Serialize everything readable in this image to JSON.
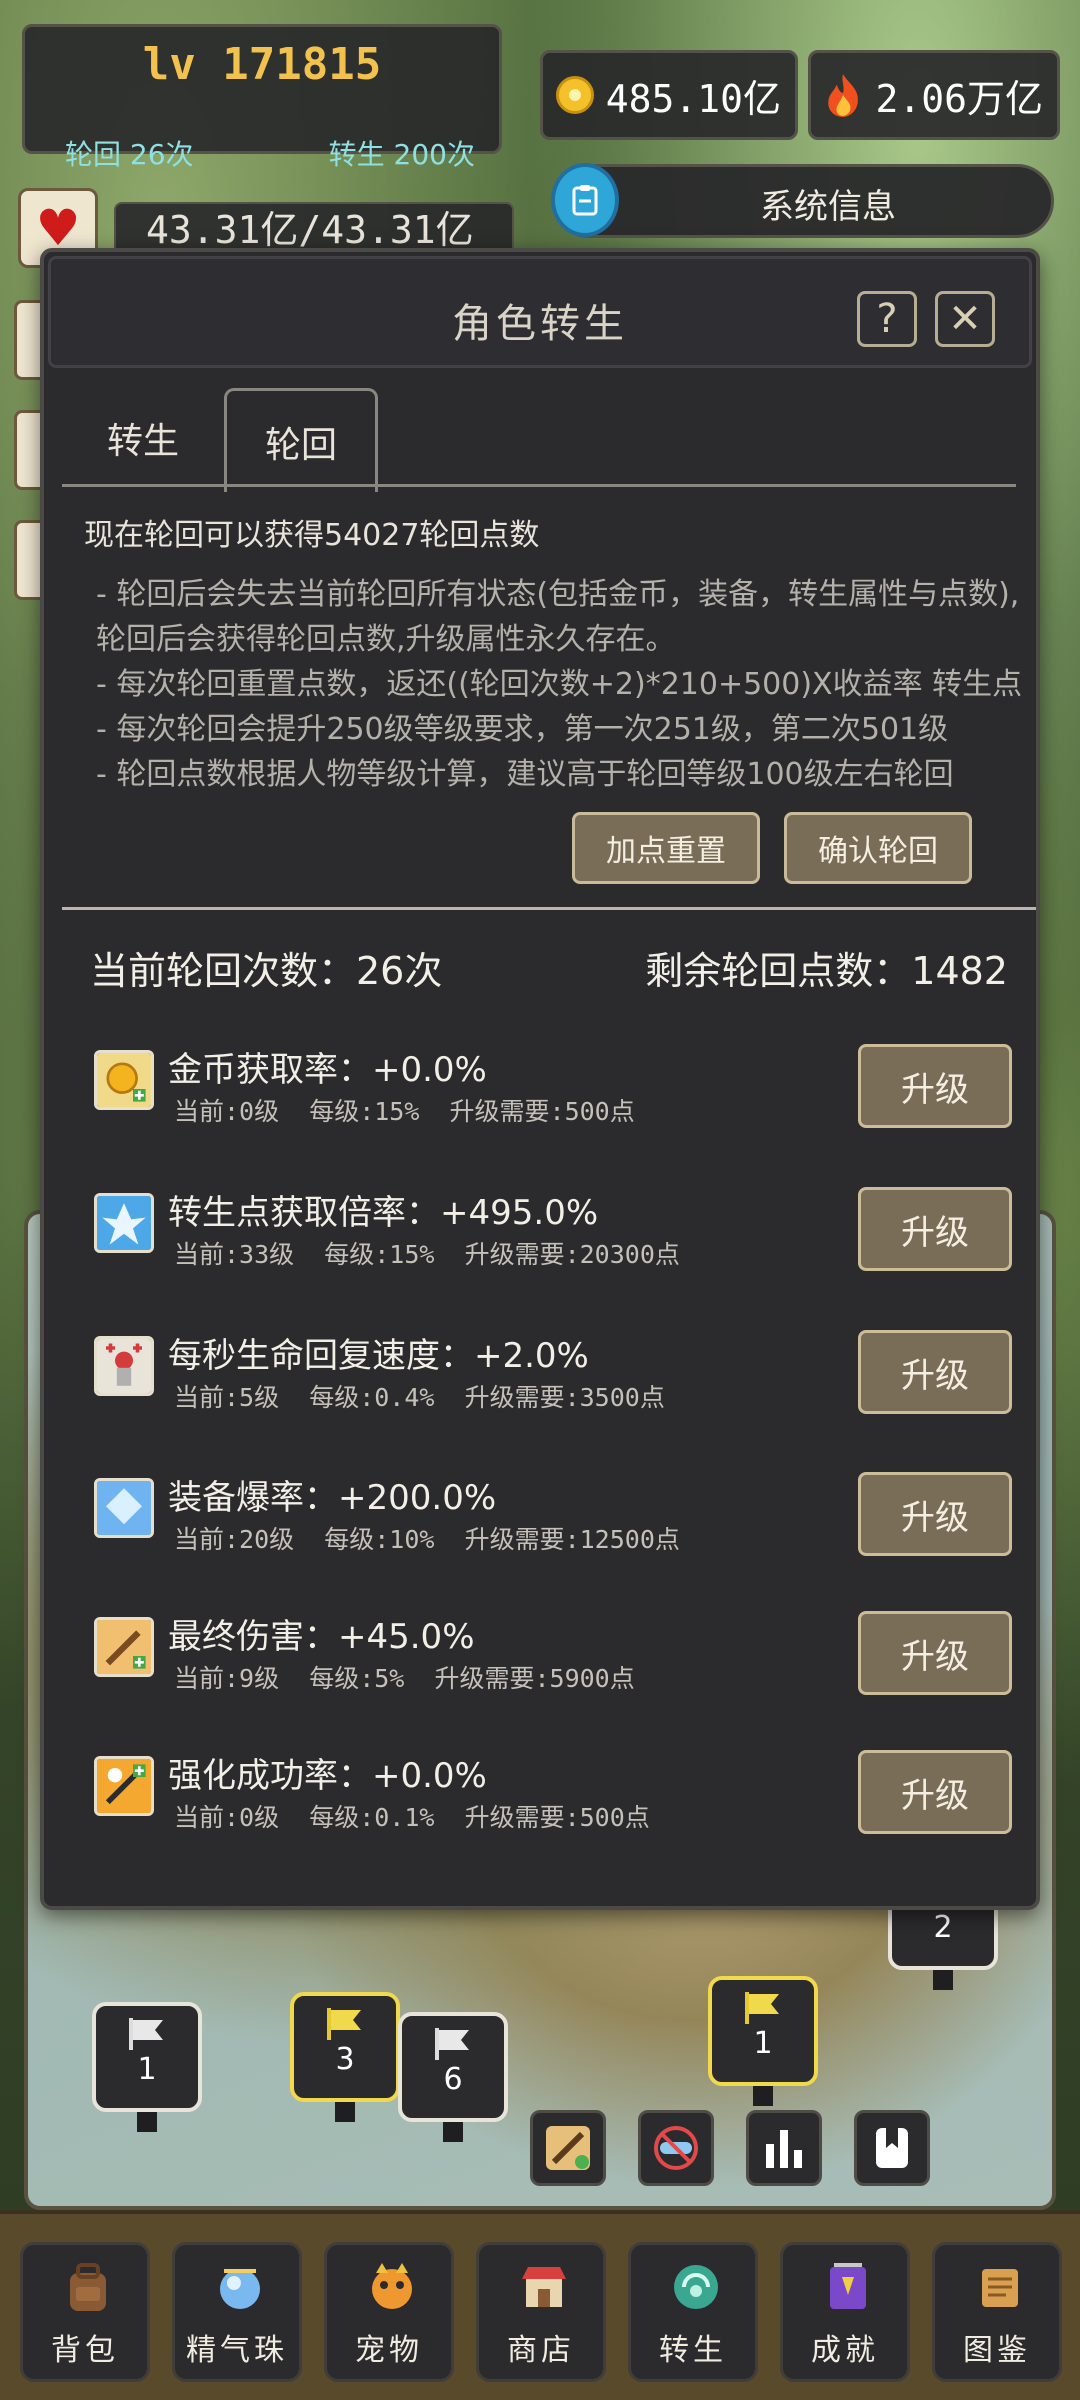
{
  "top": {
    "level": "lv 171815",
    "cycles": "轮回 26次",
    "rebirths": "转生 200次",
    "gold": "485.10亿",
    "fire": "2.06万亿",
    "hp": "43.31亿/43.31亿",
    "sysinfo_title": "系统信息"
  },
  "modal": {
    "title": "角色转生",
    "help": "?",
    "close": "✕",
    "tabs": [
      "转生",
      "轮回"
    ],
    "active_tab": "轮回",
    "info_head": "现在轮回可以获得54027轮回点数",
    "info_lines": [
      "- 轮回后会失去当前轮回所有状态(包括金币，装备，转生属性与点数),轮回后会获得轮回点数,升级属性永久存在。",
      "- 每次轮回重置点数，返还((轮回次数+2)*210+500)X收益率 转生点",
      "- 每次轮回会提升250级等级要求，第一次251级，第二次501级",
      "- 轮回点数根据人物等级计算，建议高于轮回等级100级左右轮回"
    ],
    "reset_button": "加点重置",
    "confirm_button": "确认轮回",
    "current_count": "当前轮回次数：26次",
    "remaining_points": "剩余轮回点数：1482",
    "upgrade_label": "升级",
    "attributes": [
      {
        "icon": "gold-rate-icon",
        "title": "金币获取率：+0.0%",
        "detail": "当前:0级  每级:15%  升级需要:500点"
      },
      {
        "icon": "rebirth-point-icon",
        "title": "转生点获取倍率：+495.0%",
        "detail": "当前:33级  每级:15%  升级需要:20300点"
      },
      {
        "icon": "hp-regen-icon",
        "title": "每秒生命回复速度：+2.0%",
        "detail": "当前:5级  每级:0.4%  升级需要:3500点"
      },
      {
        "icon": "drop-rate-icon",
        "title": "装备爆率：+200.0%",
        "detail": "当前:20级  每级:10%  升级需要:12500点"
      },
      {
        "icon": "final-damage-icon",
        "title": "最终伤害：+45.0%",
        "detail": "当前:9级  每级:5%  升级需要:5900点"
      },
      {
        "icon": "enhance-rate-icon",
        "title": "强化成功率：+0.0%",
        "detail": "当前:0级  每级:0.1%  升级需要:500点"
      }
    ]
  },
  "map": {
    "flags": [
      {
        "label": "1",
        "color": "white"
      },
      {
        "label": "3",
        "color": "yellow"
      },
      {
        "label": "6",
        "color": "white"
      },
      {
        "label": "1",
        "color": "yellow"
      },
      {
        "label": "2",
        "color": "white"
      }
    ]
  },
  "nav": [
    "背包",
    "精气珠",
    "宠物",
    "商店",
    "转生",
    "成就",
    "图鉴"
  ],
  "colors": {
    "accent_gold": "#f2c14e",
    "cyan_text": "#8fe0e0",
    "button_bg": "#7a6d57",
    "panel_bg": "#2b2a2d"
  }
}
